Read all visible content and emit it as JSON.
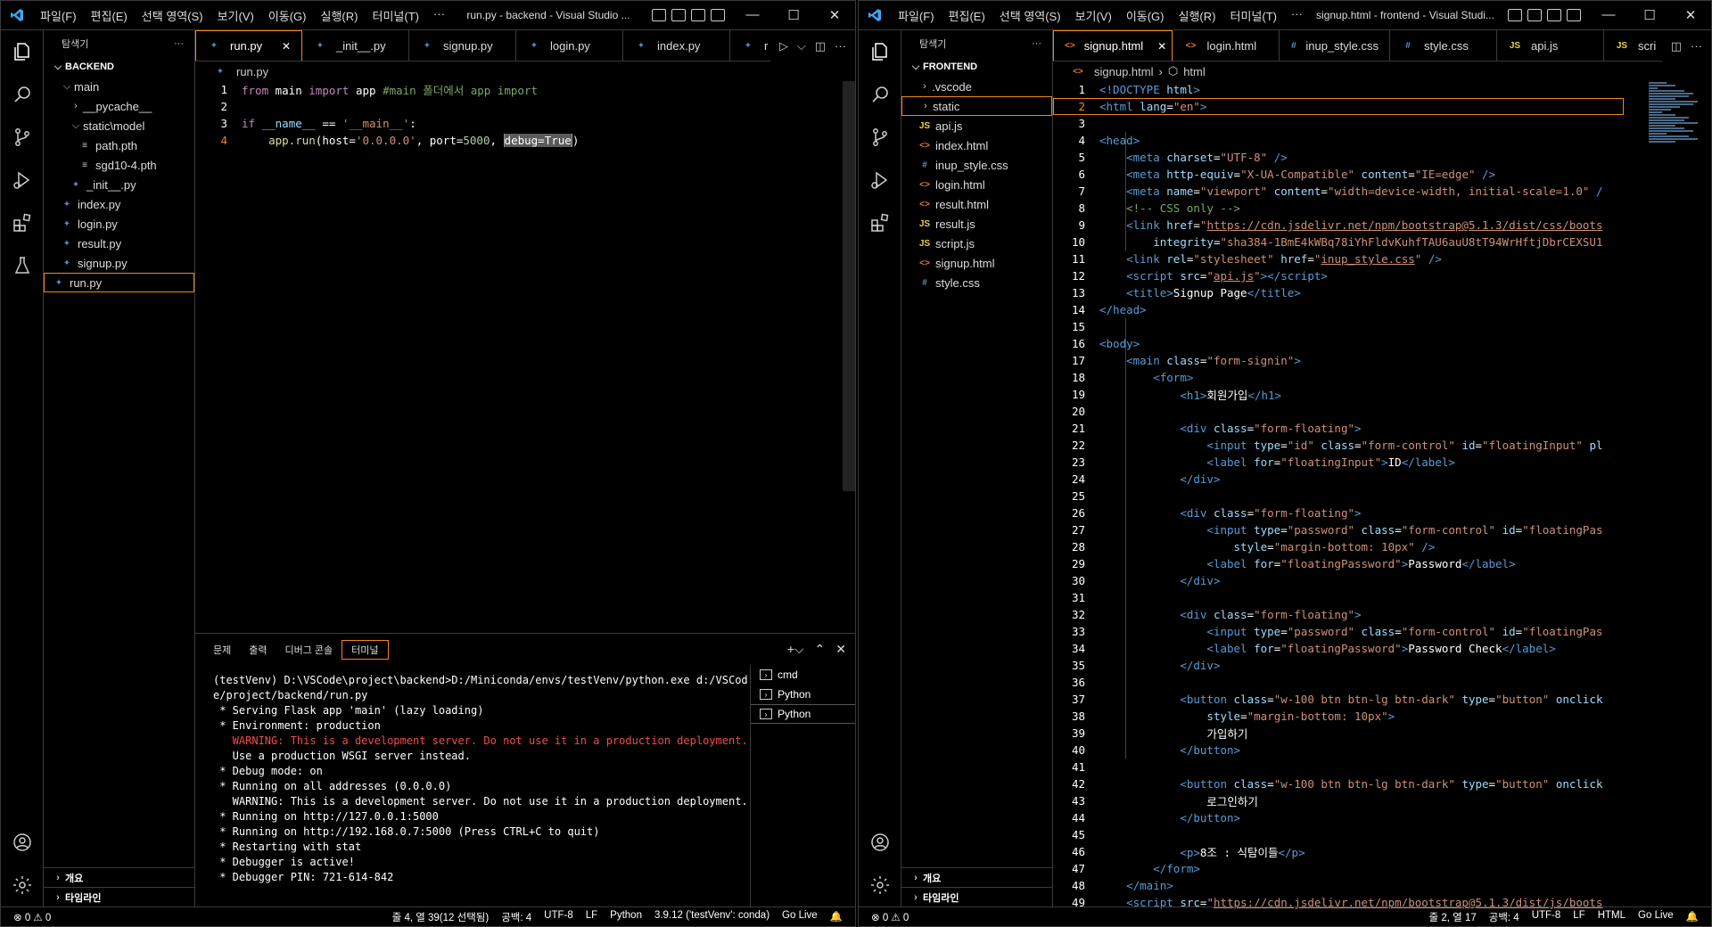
{
  "menu": [
    "파일(F)",
    "편집(E)",
    "선택 영역(S)",
    "보기(V)",
    "이동(G)",
    "실행(R)",
    "터미널(T)",
    "···"
  ],
  "left": {
    "title": "run.py - backend - Visual Studio ...",
    "explorer_label": "탐색기",
    "section": "BACKEND",
    "tree": [
      {
        "label": "main",
        "type": "folder-open",
        "indent": 1
      },
      {
        "label": "__pycache__",
        "type": "folder",
        "indent": 2
      },
      {
        "label": "static\\model",
        "type": "folder-open",
        "indent": 2
      },
      {
        "label": "path.pth",
        "type": "file",
        "indent": 3
      },
      {
        "label": "sgd10-4.pth",
        "type": "file",
        "indent": 3
      },
      {
        "label": "_init__.py",
        "type": "py",
        "indent": 2
      },
      {
        "label": "index.py",
        "type": "py",
        "indent": 1
      },
      {
        "label": "login.py",
        "type": "py",
        "indent": 1
      },
      {
        "label": "result.py",
        "type": "py",
        "indent": 1
      },
      {
        "label": "signup.py",
        "type": "py",
        "indent": 1
      },
      {
        "label": "run.py",
        "type": "py",
        "indent": 0,
        "selected": true
      }
    ],
    "footer_outline": "개요",
    "footer_timeline": "타임라인",
    "tabs": [
      {
        "label": "run.py",
        "active": true
      },
      {
        "label": "_init__.py"
      },
      {
        "label": "signup.py"
      },
      {
        "label": "login.py"
      },
      {
        "label": "index.py"
      },
      {
        "label": "r"
      }
    ],
    "breadcrumb": "run.py",
    "code": {
      "l1_kw1": "from",
      "l1_mod": " main ",
      "l1_kw2": "import",
      "l1_name": " app ",
      "l1_cmt": "#main 폴더에서 app import",
      "l3_kw": "if",
      "l3_a": " __name__ ",
      "l3_op": "==",
      "l3_str": " '__main__'",
      "l3_c": ":",
      "l4_fn": "app.run",
      "l4_a": "(host=",
      "l4_str": "'0.0.0.0'",
      "l4_b": ", port=",
      "l4_num": "5000",
      "l4_c": ", ",
      "l4_sel": "debug=True",
      "l4_d": ")"
    },
    "panel_tabs": [
      "문제",
      "출력",
      "디버그 콘솔",
      "터미널"
    ],
    "terminal": [
      {
        "text": "(testVenv) D:\\VSCode\\project\\backend>D:/Miniconda/envs/testVenv/python.exe d:/VSCod"
      },
      {
        "text": "e/project/backend/run.py"
      },
      {
        "text": " * Serving Flask app 'main' (lazy loading)"
      },
      {
        "text": " * Environment: production"
      },
      {
        "text": "   WARNING: This is a development server. Do not use it in a production deployment.",
        "warn": true
      },
      {
        "text": "   Use a production WSGI server instead."
      },
      {
        "text": " * Debug mode: on"
      },
      {
        "text": " * Running on all addresses (0.0.0.0)"
      },
      {
        "text": "   WARNING: This is a development server. Do not use it in a production deployment."
      },
      {
        "text": " * Running on http://127.0.0.1:5000"
      },
      {
        "text": " * Running on http://192.168.0.7:5000 (Press CTRL+C to quit)"
      },
      {
        "text": " * Restarting with stat"
      },
      {
        "text": " * Debugger is active!"
      },
      {
        "text": " * Debugger PIN: 721-614-842"
      }
    ],
    "terminal_list": [
      "cmd",
      "Python",
      "Python"
    ],
    "status_left": "⊗ 0 ⚠ 0",
    "status_right": [
      "줄 4, 열 39(12 선택됨)",
      "공백: 4",
      "UTF-8",
      "LF",
      "Python",
      "3.9.12 ('testVenv': conda)",
      "Go Live"
    ]
  },
  "right": {
    "title": "signup.html - frontend - Visual Studi...",
    "explorer_label": "탐색기",
    "section": "FRONTEND",
    "tree": [
      {
        "label": ".vscode",
        "type": "folder",
        "indent": 1
      },
      {
        "label": "static",
        "type": "folder",
        "indent": 1,
        "selected": true
      },
      {
        "label": "api.js",
        "type": "js",
        "indent": 1
      },
      {
        "label": "index.html",
        "type": "html",
        "indent": 1
      },
      {
        "label": "inup_style.css",
        "type": "css",
        "indent": 1
      },
      {
        "label": "login.html",
        "type": "html",
        "indent": 1
      },
      {
        "label": "result.html",
        "type": "html",
        "indent": 1
      },
      {
        "label": "result.js",
        "type": "js",
        "indent": 1
      },
      {
        "label": "script.js",
        "type": "js",
        "indent": 1
      },
      {
        "label": "signup.html",
        "type": "html",
        "indent": 1
      },
      {
        "label": "style.css",
        "type": "css",
        "indent": 1
      }
    ],
    "footer_outline": "개요",
    "footer_timeline": "타임라인",
    "tabs": [
      {
        "label": "signup.html",
        "active": true,
        "type": "html"
      },
      {
        "label": "login.html",
        "type": "html"
      },
      {
        "label": "inup_style.css",
        "type": "css"
      },
      {
        "label": "style.css",
        "type": "css"
      },
      {
        "label": "api.js",
        "type": "js"
      },
      {
        "label": "scri",
        "type": "js"
      }
    ],
    "breadcrumb_file": "signup.html",
    "breadcrumb_node": "html",
    "status_left": "⊗ 0 ⚠ 0",
    "status_right": [
      "줄 2, 열 17",
      "공백: 4",
      "UTF-8",
      "LF",
      "HTML",
      "Go Live"
    ]
  },
  "icon_colors": {
    "py": "#4b8bbe",
    "js": "#e8d44d",
    "html": "#e37933",
    "css": "#519aba",
    "accent": "#f38518"
  }
}
